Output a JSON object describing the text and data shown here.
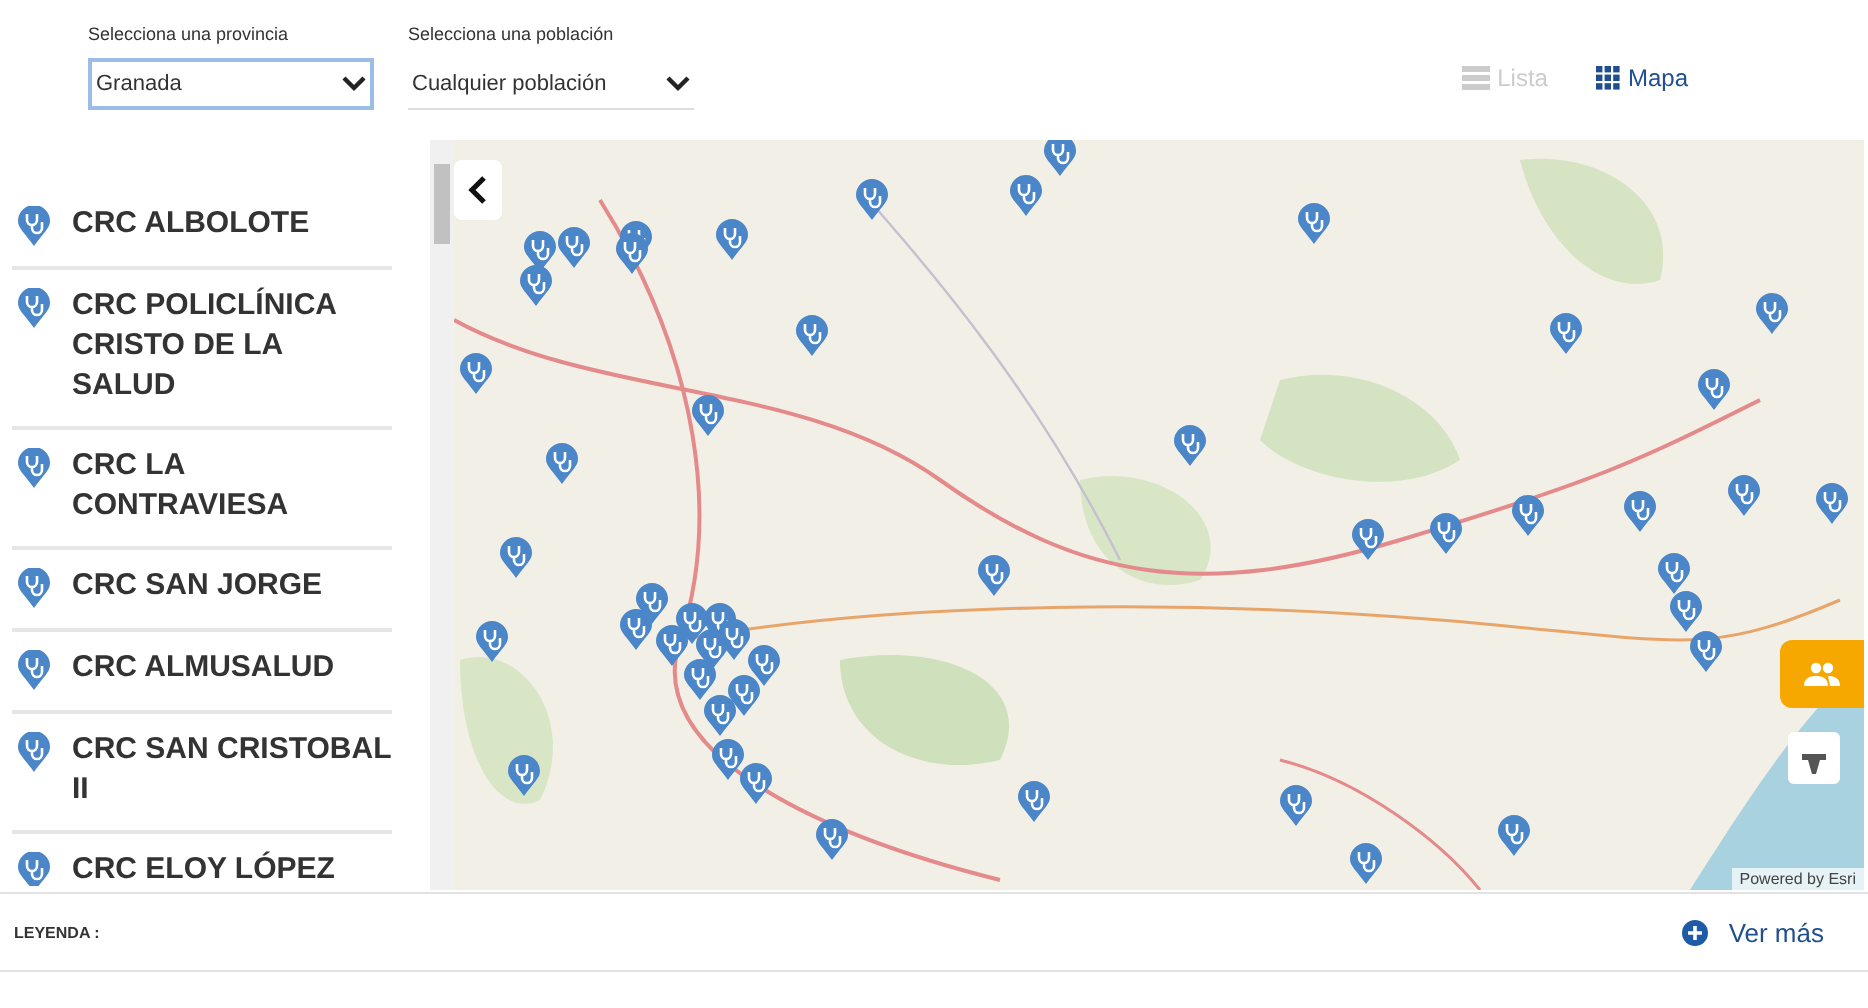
{
  "filters": [
    {
      "label": "Selecciona una provincia",
      "value": "Granada",
      "focused": true
    },
    {
      "label": "Selecciona una población",
      "value": "Cualquier población",
      "focused": false
    }
  ],
  "views": [
    {
      "label": "Lista",
      "selected": false,
      "kind": "list"
    },
    {
      "label": "Mapa",
      "selected": true,
      "kind": "grid"
    }
  ],
  "centers": [
    {
      "name": "CRC ALBOLOTE"
    },
    {
      "name": "CRC POLICLÍNICA CRISTO DE LA SALUD"
    },
    {
      "name": "CRC LA CONTRAVIESA"
    },
    {
      "name": "CRC SAN JORGE"
    },
    {
      "name": "CRC ALMUSALUD"
    },
    {
      "name": "CRC SAN CRISTOBAL II"
    },
    {
      "name": "CRC ELOY LÓPEZ"
    }
  ],
  "map": {
    "attribution": "Powered by Esri"
  },
  "legend": {
    "title": "LEYENDA :",
    "more": "Ver más"
  }
}
